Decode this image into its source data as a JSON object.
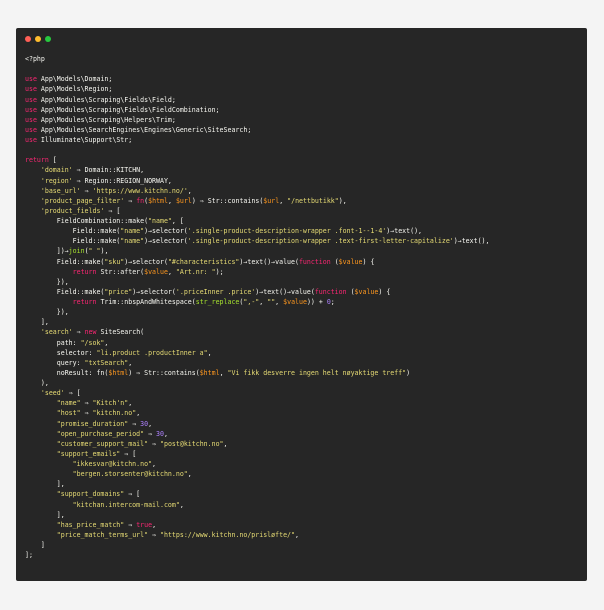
{
  "window": {
    "controls": [
      {
        "name": "close",
        "color": "#ff5f56"
      },
      {
        "name": "minimize",
        "color": "#ffbd2e"
      },
      {
        "name": "maximize",
        "color": "#27c93f"
      }
    ]
  },
  "code": {
    "language": "php",
    "lines": [
      [
        {
          "t": "plain",
          "v": "<?php"
        }
      ],
      [],
      [
        {
          "t": "kw",
          "v": "use"
        },
        {
          "t": "plain",
          "v": " App\\Models\\Domain;"
        }
      ],
      [
        {
          "t": "kw",
          "v": "use"
        },
        {
          "t": "plain",
          "v": " App\\Models\\Region;"
        }
      ],
      [
        {
          "t": "kw",
          "v": "use"
        },
        {
          "t": "plain",
          "v": " App\\Modules\\Scraping\\Fields\\Field;"
        }
      ],
      [
        {
          "t": "kw",
          "v": "use"
        },
        {
          "t": "plain",
          "v": " App\\Modules\\Scraping\\Fields\\FieldCombination;"
        }
      ],
      [
        {
          "t": "kw",
          "v": "use"
        },
        {
          "t": "plain",
          "v": " App\\Modules\\Scraping\\Helpers\\Trim;"
        }
      ],
      [
        {
          "t": "kw",
          "v": "use"
        },
        {
          "t": "plain",
          "v": " App\\Modules\\SearchEngines\\Engines\\Generic\\SiteSearch;"
        }
      ],
      [
        {
          "t": "kw",
          "v": "use"
        },
        {
          "t": "plain",
          "v": " Illuminate\\Support\\Str;"
        }
      ],
      [],
      [
        {
          "t": "kw",
          "v": "return"
        },
        {
          "t": "plain",
          "v": " ["
        }
      ],
      [
        {
          "t": "plain",
          "v": "    "
        },
        {
          "t": "str",
          "v": "'domain'"
        },
        {
          "t": "plain",
          "v": " ⇒ Domain::KITCHN,"
        }
      ],
      [
        {
          "t": "plain",
          "v": "    "
        },
        {
          "t": "str",
          "v": "'region'"
        },
        {
          "t": "plain",
          "v": " ⇒ Region::REGION_NORWAY,"
        }
      ],
      [
        {
          "t": "plain",
          "v": "    "
        },
        {
          "t": "str",
          "v": "'base_url'"
        },
        {
          "t": "plain",
          "v": " ⇒ "
        },
        {
          "t": "str",
          "v": "'https://www.kitchn.no/'"
        },
        {
          "t": "plain",
          "v": ","
        }
      ],
      [
        {
          "t": "plain",
          "v": "    "
        },
        {
          "t": "str",
          "v": "'product_page_filter'"
        },
        {
          "t": "plain",
          "v": " ⇒ "
        },
        {
          "t": "kw",
          "v": "fn"
        },
        {
          "t": "plain",
          "v": "("
        },
        {
          "t": "var",
          "v": "$html"
        },
        {
          "t": "plain",
          "v": ", "
        },
        {
          "t": "var",
          "v": "$url"
        },
        {
          "t": "plain",
          "v": ") ⇒ Str::contains("
        },
        {
          "t": "var",
          "v": "$url"
        },
        {
          "t": "plain",
          "v": ", "
        },
        {
          "t": "str",
          "v": "\"/nettbutikk\""
        },
        {
          "t": "plain",
          "v": "),"
        }
      ],
      [
        {
          "t": "plain",
          "v": "    "
        },
        {
          "t": "str",
          "v": "'product_fields'"
        },
        {
          "t": "plain",
          "v": " ⇒ ["
        }
      ],
      [
        {
          "t": "plain",
          "v": "        FieldCombination::make("
        },
        {
          "t": "str",
          "v": "\"name\""
        },
        {
          "t": "plain",
          "v": ", ["
        }
      ],
      [
        {
          "t": "plain",
          "v": "            Field::make("
        },
        {
          "t": "str",
          "v": "\"name\""
        },
        {
          "t": "plain",
          "v": ")→selector("
        },
        {
          "t": "str",
          "v": "'.single-product-description-wrapper .font-1--1-4'"
        },
        {
          "t": "plain",
          "v": ")→text(),"
        }
      ],
      [
        {
          "t": "plain",
          "v": "            Field::make("
        },
        {
          "t": "str",
          "v": "\"name\""
        },
        {
          "t": "plain",
          "v": ")→selector("
        },
        {
          "t": "str",
          "v": "'.single-product-description-wrapper .text-first-letter-capitalize'"
        },
        {
          "t": "plain",
          "v": ")→text(),"
        }
      ],
      [
        {
          "t": "plain",
          "v": "        ])→"
        },
        {
          "t": "fn",
          "v": "join"
        },
        {
          "t": "plain",
          "v": "("
        },
        {
          "t": "str",
          "v": "\" \""
        },
        {
          "t": "plain",
          "v": "),"
        }
      ],
      [
        {
          "t": "plain",
          "v": "        Field::make("
        },
        {
          "t": "str",
          "v": "\"sku\""
        },
        {
          "t": "plain",
          "v": ")→selector("
        },
        {
          "t": "str",
          "v": "\"#characteristics\""
        },
        {
          "t": "plain",
          "v": ")→text()→value("
        },
        {
          "t": "kw",
          "v": "function"
        },
        {
          "t": "plain",
          "v": " ("
        },
        {
          "t": "var",
          "v": "$value"
        },
        {
          "t": "plain",
          "v": ") {"
        }
      ],
      [
        {
          "t": "plain",
          "v": "            "
        },
        {
          "t": "kw",
          "v": "return"
        },
        {
          "t": "plain",
          "v": " Str::after("
        },
        {
          "t": "var",
          "v": "$value"
        },
        {
          "t": "plain",
          "v": ", "
        },
        {
          "t": "str",
          "v": "\"Art.nr: \""
        },
        {
          "t": "plain",
          "v": ");"
        }
      ],
      [
        {
          "t": "plain",
          "v": "        }),"
        }
      ],
      [
        {
          "t": "plain",
          "v": "        Field::make("
        },
        {
          "t": "str",
          "v": "\"price\""
        },
        {
          "t": "plain",
          "v": ")→selector("
        },
        {
          "t": "str",
          "v": "'.priceInner .price'"
        },
        {
          "t": "plain",
          "v": ")→text()→value("
        },
        {
          "t": "kw",
          "v": "function"
        },
        {
          "t": "plain",
          "v": " ("
        },
        {
          "t": "var",
          "v": "$value"
        },
        {
          "t": "plain",
          "v": ") {"
        }
      ],
      [
        {
          "t": "plain",
          "v": "            "
        },
        {
          "t": "kw",
          "v": "return"
        },
        {
          "t": "plain",
          "v": " Trim::nbspAndWhitespace("
        },
        {
          "t": "fn",
          "v": "str_replace"
        },
        {
          "t": "plain",
          "v": "("
        },
        {
          "t": "str",
          "v": "\",-\""
        },
        {
          "t": "plain",
          "v": ", "
        },
        {
          "t": "str",
          "v": "\"\""
        },
        {
          "t": "plain",
          "v": ", "
        },
        {
          "t": "var",
          "v": "$value"
        },
        {
          "t": "plain",
          "v": ")) + "
        },
        {
          "t": "num",
          "v": "0"
        },
        {
          "t": "plain",
          "v": ";"
        }
      ],
      [
        {
          "t": "plain",
          "v": "        }),"
        }
      ],
      [
        {
          "t": "plain",
          "v": "    ],"
        }
      ],
      [
        {
          "t": "plain",
          "v": "    "
        },
        {
          "t": "str",
          "v": "'search'"
        },
        {
          "t": "plain",
          "v": " ⇒ "
        },
        {
          "t": "kw",
          "v": "new"
        },
        {
          "t": "plain",
          "v": " SiteSearch("
        }
      ],
      [
        {
          "t": "plain",
          "v": "        path: "
        },
        {
          "t": "str",
          "v": "\"/sok\""
        },
        {
          "t": "plain",
          "v": ","
        }
      ],
      [
        {
          "t": "plain",
          "v": "        selector: "
        },
        {
          "t": "str",
          "v": "\"li.product .productInner a\""
        },
        {
          "t": "plain",
          "v": ","
        }
      ],
      [
        {
          "t": "plain",
          "v": "        query: "
        },
        {
          "t": "str",
          "v": "\"txtSearch\""
        },
        {
          "t": "plain",
          "v": ","
        }
      ],
      [
        {
          "t": "plain",
          "v": "        noResult: fn("
        },
        {
          "t": "var",
          "v": "$html"
        },
        {
          "t": "plain",
          "v": ") ⇒ Str::contains("
        },
        {
          "t": "var",
          "v": "$html"
        },
        {
          "t": "plain",
          "v": ", "
        },
        {
          "t": "str",
          "v": "\"Vi fikk desverre ingen helt nøyaktige treff\""
        },
        {
          "t": "plain",
          "v": ")"
        }
      ],
      [
        {
          "t": "plain",
          "v": "    ),"
        }
      ],
      [
        {
          "t": "plain",
          "v": "    "
        },
        {
          "t": "str",
          "v": "'seed'"
        },
        {
          "t": "plain",
          "v": " ⇒ ["
        }
      ],
      [
        {
          "t": "plain",
          "v": "        "
        },
        {
          "t": "str",
          "v": "\"name\""
        },
        {
          "t": "plain",
          "v": " ⇒ "
        },
        {
          "t": "str",
          "v": "\"Kitch'n\""
        },
        {
          "t": "plain",
          "v": ","
        }
      ],
      [
        {
          "t": "plain",
          "v": "        "
        },
        {
          "t": "str",
          "v": "\"host\""
        },
        {
          "t": "plain",
          "v": " ⇒ "
        },
        {
          "t": "str",
          "v": "\"kitchn.no\""
        },
        {
          "t": "plain",
          "v": ","
        }
      ],
      [
        {
          "t": "plain",
          "v": "        "
        },
        {
          "t": "str",
          "v": "\"promise_duration\""
        },
        {
          "t": "plain",
          "v": " ⇒ "
        },
        {
          "t": "num",
          "v": "30"
        },
        {
          "t": "plain",
          "v": ","
        }
      ],
      [
        {
          "t": "plain",
          "v": "        "
        },
        {
          "t": "str",
          "v": "\"open_purchase_period\""
        },
        {
          "t": "plain",
          "v": " ⇒ "
        },
        {
          "t": "num",
          "v": "30"
        },
        {
          "t": "plain",
          "v": ","
        }
      ],
      [
        {
          "t": "plain",
          "v": "        "
        },
        {
          "t": "str",
          "v": "\"customer_support_mail\""
        },
        {
          "t": "plain",
          "v": " ⇒ "
        },
        {
          "t": "str",
          "v": "\"post@kitchn.no\""
        },
        {
          "t": "plain",
          "v": ","
        }
      ],
      [
        {
          "t": "plain",
          "v": "        "
        },
        {
          "t": "str",
          "v": "\"support_emails\""
        },
        {
          "t": "plain",
          "v": " ⇒ ["
        }
      ],
      [
        {
          "t": "plain",
          "v": "            "
        },
        {
          "t": "str",
          "v": "\"ikkesvar@kitchn.no\""
        },
        {
          "t": "plain",
          "v": ","
        }
      ],
      [
        {
          "t": "plain",
          "v": "            "
        },
        {
          "t": "str",
          "v": "\"bergen.storsenter@kitchn.no\""
        },
        {
          "t": "plain",
          "v": ","
        }
      ],
      [
        {
          "t": "plain",
          "v": "        ],"
        }
      ],
      [
        {
          "t": "plain",
          "v": "        "
        },
        {
          "t": "str",
          "v": "\"support_domains\""
        },
        {
          "t": "plain",
          "v": " ⇒ ["
        }
      ],
      [
        {
          "t": "plain",
          "v": "            "
        },
        {
          "t": "str",
          "v": "\"kitchan.intercom-mail.com\""
        },
        {
          "t": "plain",
          "v": ","
        }
      ],
      [
        {
          "t": "plain",
          "v": "        ],"
        }
      ],
      [
        {
          "t": "plain",
          "v": "        "
        },
        {
          "t": "str",
          "v": "\"has_price_match\""
        },
        {
          "t": "plain",
          "v": " ⇒ "
        },
        {
          "t": "kw",
          "v": "true"
        },
        {
          "t": "plain",
          "v": ","
        }
      ],
      [
        {
          "t": "plain",
          "v": "        "
        },
        {
          "t": "str",
          "v": "\"price_match_terms_url\""
        },
        {
          "t": "plain",
          "v": " ⇒ "
        },
        {
          "t": "str",
          "v": "\"https://www.kitchn.no/prisløfte/\""
        },
        {
          "t": "plain",
          "v": ","
        }
      ],
      [
        {
          "t": "plain",
          "v": "    ]"
        }
      ],
      [
        {
          "t": "plain",
          "v": "];"
        }
      ]
    ]
  }
}
